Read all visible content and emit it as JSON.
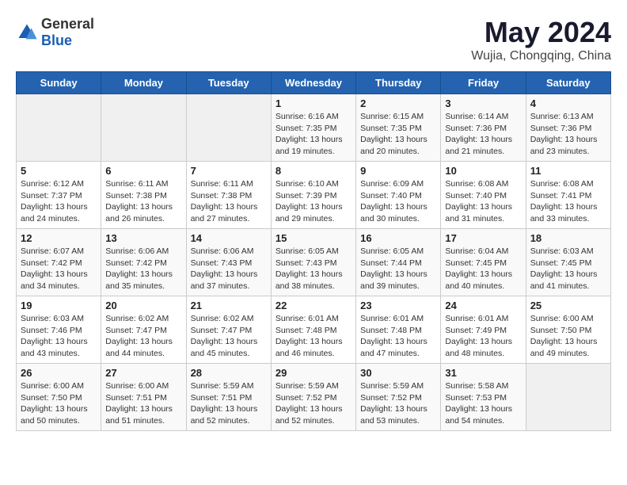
{
  "logo": {
    "general": "General",
    "blue": "Blue"
  },
  "title": "May 2024",
  "subtitle": "Wujia, Chongqing, China",
  "days_header": [
    "Sunday",
    "Monday",
    "Tuesday",
    "Wednesday",
    "Thursday",
    "Friday",
    "Saturday"
  ],
  "weeks": [
    [
      {
        "day": "",
        "info": ""
      },
      {
        "day": "",
        "info": ""
      },
      {
        "day": "",
        "info": ""
      },
      {
        "day": "1",
        "info": "Sunrise: 6:16 AM\nSunset: 7:35 PM\nDaylight: 13 hours\nand 19 minutes."
      },
      {
        "day": "2",
        "info": "Sunrise: 6:15 AM\nSunset: 7:35 PM\nDaylight: 13 hours\nand 20 minutes."
      },
      {
        "day": "3",
        "info": "Sunrise: 6:14 AM\nSunset: 7:36 PM\nDaylight: 13 hours\nand 21 minutes."
      },
      {
        "day": "4",
        "info": "Sunrise: 6:13 AM\nSunset: 7:36 PM\nDaylight: 13 hours\nand 23 minutes."
      }
    ],
    [
      {
        "day": "5",
        "info": "Sunrise: 6:12 AM\nSunset: 7:37 PM\nDaylight: 13 hours\nand 24 minutes."
      },
      {
        "day": "6",
        "info": "Sunrise: 6:11 AM\nSunset: 7:38 PM\nDaylight: 13 hours\nand 26 minutes."
      },
      {
        "day": "7",
        "info": "Sunrise: 6:11 AM\nSunset: 7:38 PM\nDaylight: 13 hours\nand 27 minutes."
      },
      {
        "day": "8",
        "info": "Sunrise: 6:10 AM\nSunset: 7:39 PM\nDaylight: 13 hours\nand 29 minutes."
      },
      {
        "day": "9",
        "info": "Sunrise: 6:09 AM\nSunset: 7:40 PM\nDaylight: 13 hours\nand 30 minutes."
      },
      {
        "day": "10",
        "info": "Sunrise: 6:08 AM\nSunset: 7:40 PM\nDaylight: 13 hours\nand 31 minutes."
      },
      {
        "day": "11",
        "info": "Sunrise: 6:08 AM\nSunset: 7:41 PM\nDaylight: 13 hours\nand 33 minutes."
      }
    ],
    [
      {
        "day": "12",
        "info": "Sunrise: 6:07 AM\nSunset: 7:42 PM\nDaylight: 13 hours\nand 34 minutes."
      },
      {
        "day": "13",
        "info": "Sunrise: 6:06 AM\nSunset: 7:42 PM\nDaylight: 13 hours\nand 35 minutes."
      },
      {
        "day": "14",
        "info": "Sunrise: 6:06 AM\nSunset: 7:43 PM\nDaylight: 13 hours\nand 37 minutes."
      },
      {
        "day": "15",
        "info": "Sunrise: 6:05 AM\nSunset: 7:43 PM\nDaylight: 13 hours\nand 38 minutes."
      },
      {
        "day": "16",
        "info": "Sunrise: 6:05 AM\nSunset: 7:44 PM\nDaylight: 13 hours\nand 39 minutes."
      },
      {
        "day": "17",
        "info": "Sunrise: 6:04 AM\nSunset: 7:45 PM\nDaylight: 13 hours\nand 40 minutes."
      },
      {
        "day": "18",
        "info": "Sunrise: 6:03 AM\nSunset: 7:45 PM\nDaylight: 13 hours\nand 41 minutes."
      }
    ],
    [
      {
        "day": "19",
        "info": "Sunrise: 6:03 AM\nSunset: 7:46 PM\nDaylight: 13 hours\nand 43 minutes."
      },
      {
        "day": "20",
        "info": "Sunrise: 6:02 AM\nSunset: 7:47 PM\nDaylight: 13 hours\nand 44 minutes."
      },
      {
        "day": "21",
        "info": "Sunrise: 6:02 AM\nSunset: 7:47 PM\nDaylight: 13 hours\nand 45 minutes."
      },
      {
        "day": "22",
        "info": "Sunrise: 6:01 AM\nSunset: 7:48 PM\nDaylight: 13 hours\nand 46 minutes."
      },
      {
        "day": "23",
        "info": "Sunrise: 6:01 AM\nSunset: 7:48 PM\nDaylight: 13 hours\nand 47 minutes."
      },
      {
        "day": "24",
        "info": "Sunrise: 6:01 AM\nSunset: 7:49 PM\nDaylight: 13 hours\nand 48 minutes."
      },
      {
        "day": "25",
        "info": "Sunrise: 6:00 AM\nSunset: 7:50 PM\nDaylight: 13 hours\nand 49 minutes."
      }
    ],
    [
      {
        "day": "26",
        "info": "Sunrise: 6:00 AM\nSunset: 7:50 PM\nDaylight: 13 hours\nand 50 minutes."
      },
      {
        "day": "27",
        "info": "Sunrise: 6:00 AM\nSunset: 7:51 PM\nDaylight: 13 hours\nand 51 minutes."
      },
      {
        "day": "28",
        "info": "Sunrise: 5:59 AM\nSunset: 7:51 PM\nDaylight: 13 hours\nand 52 minutes."
      },
      {
        "day": "29",
        "info": "Sunrise: 5:59 AM\nSunset: 7:52 PM\nDaylight: 13 hours\nand 52 minutes."
      },
      {
        "day": "30",
        "info": "Sunrise: 5:59 AM\nSunset: 7:52 PM\nDaylight: 13 hours\nand 53 minutes."
      },
      {
        "day": "31",
        "info": "Sunrise: 5:58 AM\nSunset: 7:53 PM\nDaylight: 13 hours\nand 54 minutes."
      },
      {
        "day": "",
        "info": ""
      }
    ]
  ]
}
